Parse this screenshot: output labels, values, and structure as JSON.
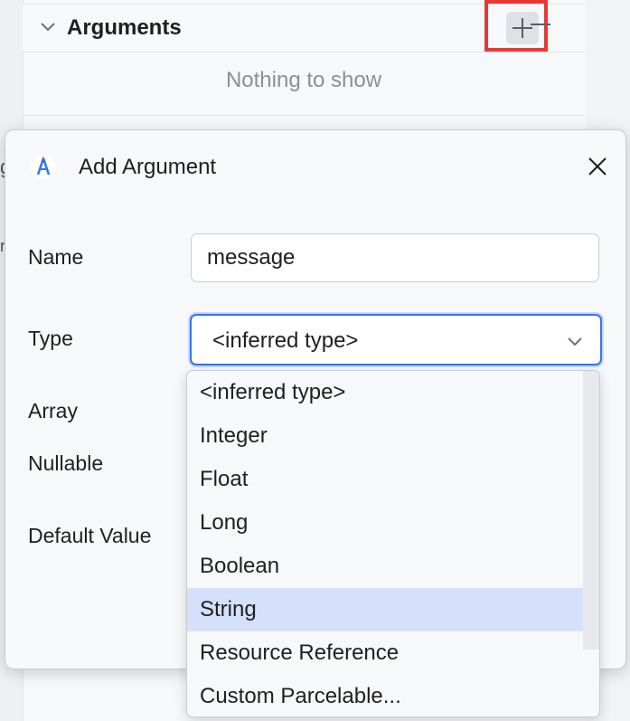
{
  "background": {
    "section_title": "Arguments",
    "empty_text": "Nothing to show",
    "clipped_char_1": "g",
    "clipped_char_2": "r"
  },
  "dialog": {
    "title": "Add Argument",
    "fields": {
      "name_label": "Name",
      "name_value": "message",
      "type_label": "Type",
      "type_value": "<inferred type>",
      "array_label": "Array",
      "nullable_label": "Nullable",
      "default_value_label": "Default Value"
    }
  },
  "dropdown": {
    "options": [
      "<inferred type>",
      "Integer",
      "Float",
      "Long",
      "Boolean",
      "String",
      "Resource Reference",
      "Custom Parcelable..."
    ],
    "highlighted": "String"
  },
  "icons": {
    "section_toggle": "chevron-down-icon",
    "add": "plus-icon",
    "remove": "minus-icon",
    "dialog_app": "android-studio-icon",
    "close": "close-icon",
    "select_toggle": "chevron-down-icon"
  },
  "colors": {
    "accent": "#3574f0",
    "highlight_row": "#d5e1fb",
    "annotation_box": "#e53935"
  }
}
